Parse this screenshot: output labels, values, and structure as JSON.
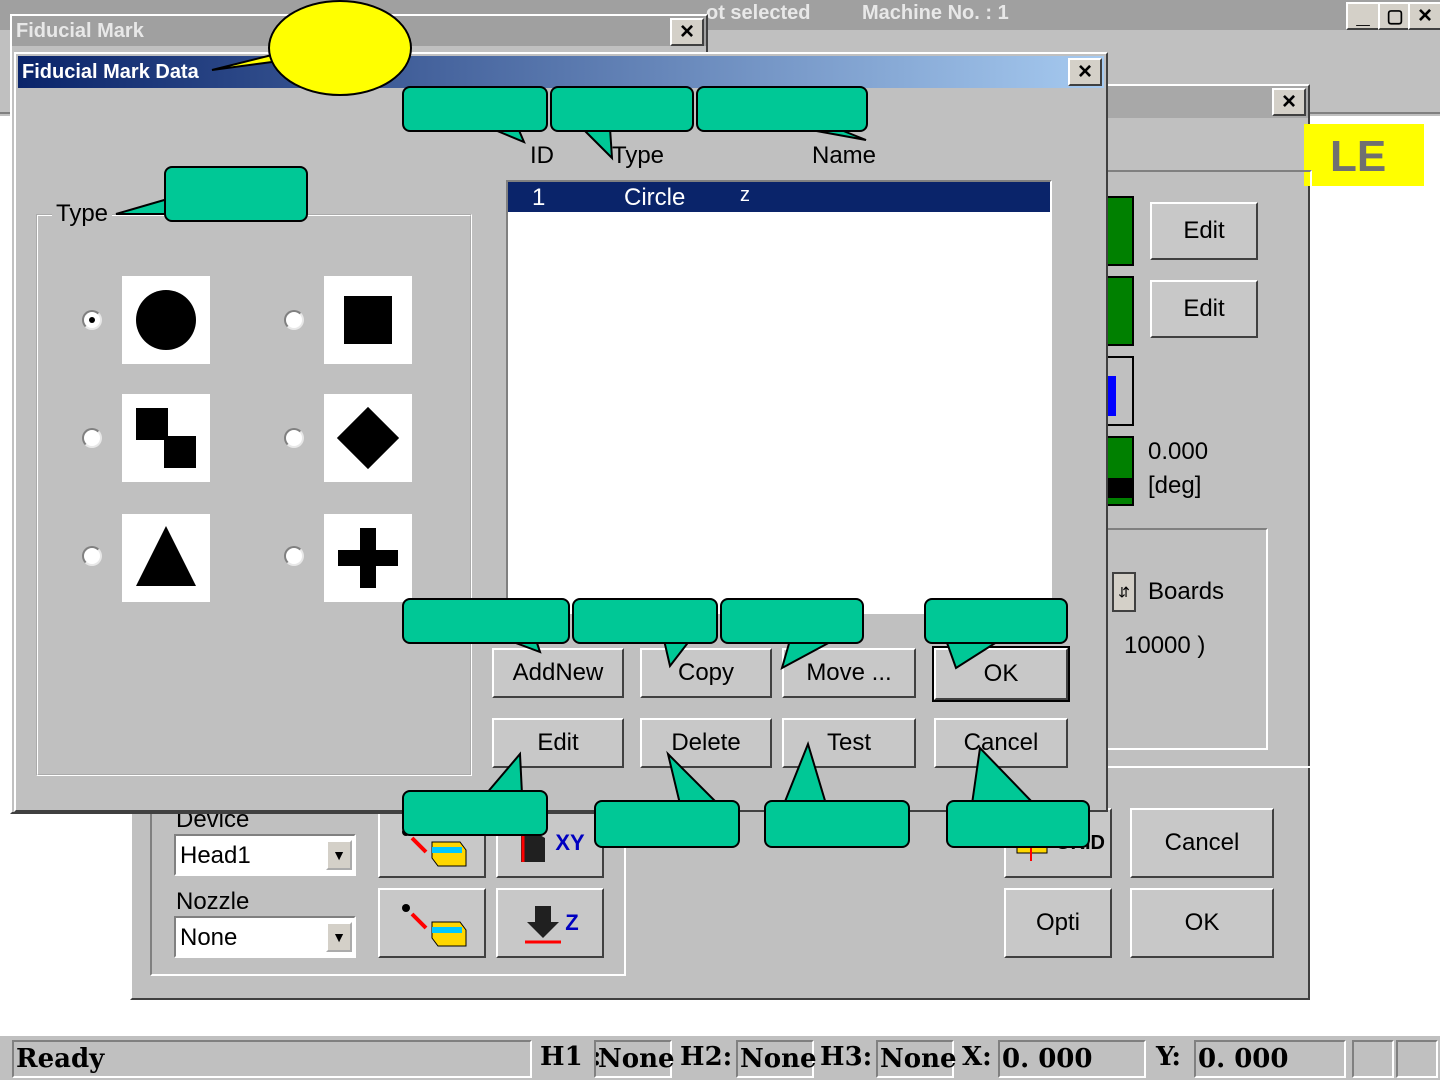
{
  "main_window": {
    "title_visible": "ot selected",
    "machine": "Machine No. : 1",
    "banner": "LE"
  },
  "back_dialog": {
    "edit_label_1": "Edit",
    "edit_label_2": "Edit",
    "angle_value": "0.000",
    "angle_unit": "[deg]",
    "boards_label": "Boards",
    "count_text": "10000 )",
    "device_label": "Device",
    "device_value": "Head1",
    "nozzle_label": "Nozzle",
    "nozzle_value": "None",
    "xy_label": "XY",
    "z_label": "Z",
    "cancel_label": "Cancel",
    "ok_label": "OK",
    "opti_label": "Opti",
    "grid_text": "GRID"
  },
  "fiducial_mark": {
    "title": "Fiducial Mark"
  },
  "fiducial_mark_data": {
    "title": "Fiducial Mark Data",
    "type_group_label": "Type",
    "columns": {
      "id": "ID",
      "type": "Type",
      "name": "Name"
    },
    "rows": [
      {
        "id": "1",
        "type": "Circle",
        "name": "z"
      }
    ],
    "buttons": {
      "add_new": "AddNew",
      "copy": "Copy",
      "move": "Move ...",
      "ok": "OK",
      "edit": "Edit",
      "delete": "Delete",
      "test": "Test",
      "cancel": "Cancel"
    },
    "shapes": [
      "circle",
      "square",
      "offset-squares",
      "diamond",
      "triangle",
      "cross"
    ],
    "selected_shape": "circle"
  },
  "status_bar": {
    "ready": "Ready",
    "h1_label": "H1 :",
    "h1_value": "None",
    "h2_label": "H2:",
    "h2_value": "None",
    "h3_label": "H3:",
    "h3_value": "None",
    "x_label": "X:",
    "x_value": "0. 000",
    "y_label": "Y:",
    "y_value": "0. 000"
  },
  "colors": {
    "callout_green": "#00c896",
    "callout_yellow": "#ffff00",
    "selection": "#0a246a",
    "title_inactive": "#808080"
  }
}
